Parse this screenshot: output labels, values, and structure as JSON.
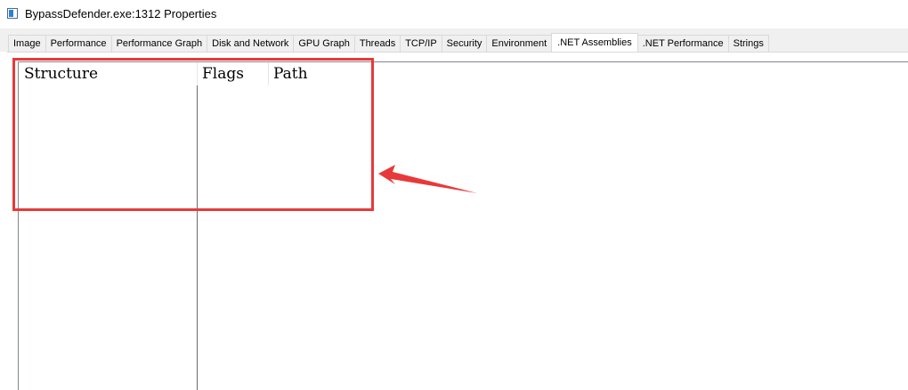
{
  "window": {
    "title": "BypassDefender.exe:1312 Properties",
    "icon": "window-app-icon"
  },
  "tabs": [
    {
      "label": "Image",
      "active": false
    },
    {
      "label": "Performance",
      "active": false
    },
    {
      "label": "Performance Graph",
      "active": false
    },
    {
      "label": "Disk and Network",
      "active": false
    },
    {
      "label": "GPU Graph",
      "active": false
    },
    {
      "label": "Threads",
      "active": false
    },
    {
      "label": "TCP/IP",
      "active": false
    },
    {
      "label": "Security",
      "active": false
    },
    {
      "label": "Environment",
      "active": false
    },
    {
      "label": ".NET Assemblies",
      "active": true
    },
    {
      "label": ".NET Performance",
      "active": false
    },
    {
      "label": "Strings",
      "active": false
    }
  ],
  "assemblies": {
    "columns": [
      "Structure",
      "Flags",
      "Path"
    ],
    "rows": []
  },
  "annotation": {
    "color": "#e8393a",
    "shapes": [
      "highlight-box",
      "arrow-pointer"
    ]
  }
}
